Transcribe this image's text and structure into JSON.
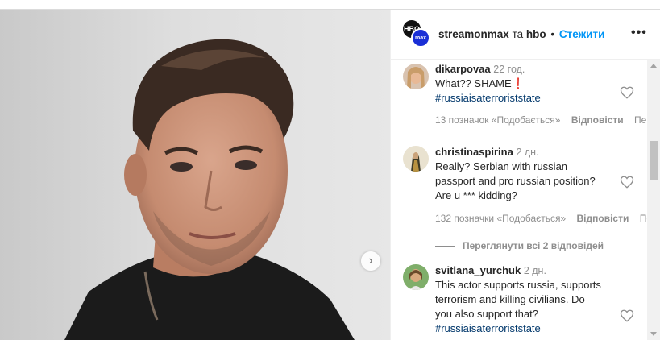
{
  "header": {
    "username": "streamonmax",
    "conjunction": "та",
    "coauthor": "hbo",
    "separator": "•",
    "follow_label": "Стежити",
    "more_label": "•••",
    "avatar_text_top": "HBO",
    "avatar_text_bottom": "max"
  },
  "carousel": {
    "next_label": "›"
  },
  "comments": [
    {
      "username": "dikarpovaa",
      "time": "22 год.",
      "text": "What?? SHAME",
      "emoji": "❗",
      "hashtag": "#russiaisaterroriststate",
      "likes": "13 позначок «Подобається»",
      "reply": "Відповісти",
      "more": "Пер"
    },
    {
      "username": "christinaspirina",
      "time": "2 дн.",
      "text_line1": "Really? Serbian with russian",
      "text_line2": "passport and pro russian position?",
      "text_line3": "Are u *** kidding?",
      "likes": "132 позначки «Подобається»",
      "reply": "Відповісти",
      "more": "Пе",
      "view_replies": "Переглянути всі 2 відповідей"
    },
    {
      "username": "svitlana_yurchuk",
      "time": "2 дн.",
      "text_line1": "This actor supports russia, supports",
      "text_line2": "terrorism and killing civilians. Do",
      "text_line3": "you also support that?",
      "hashtag": "#russiaisaterroriststate"
    }
  ],
  "colors": {
    "follow": "#0095f6",
    "hashtag": "#00376b",
    "muted": "#8e8e8e",
    "text": "#262626",
    "hbo_max_blue": "#1a2fd6"
  },
  "icons": [
    "heart-icon",
    "more-icon",
    "chevron-right-icon"
  ]
}
